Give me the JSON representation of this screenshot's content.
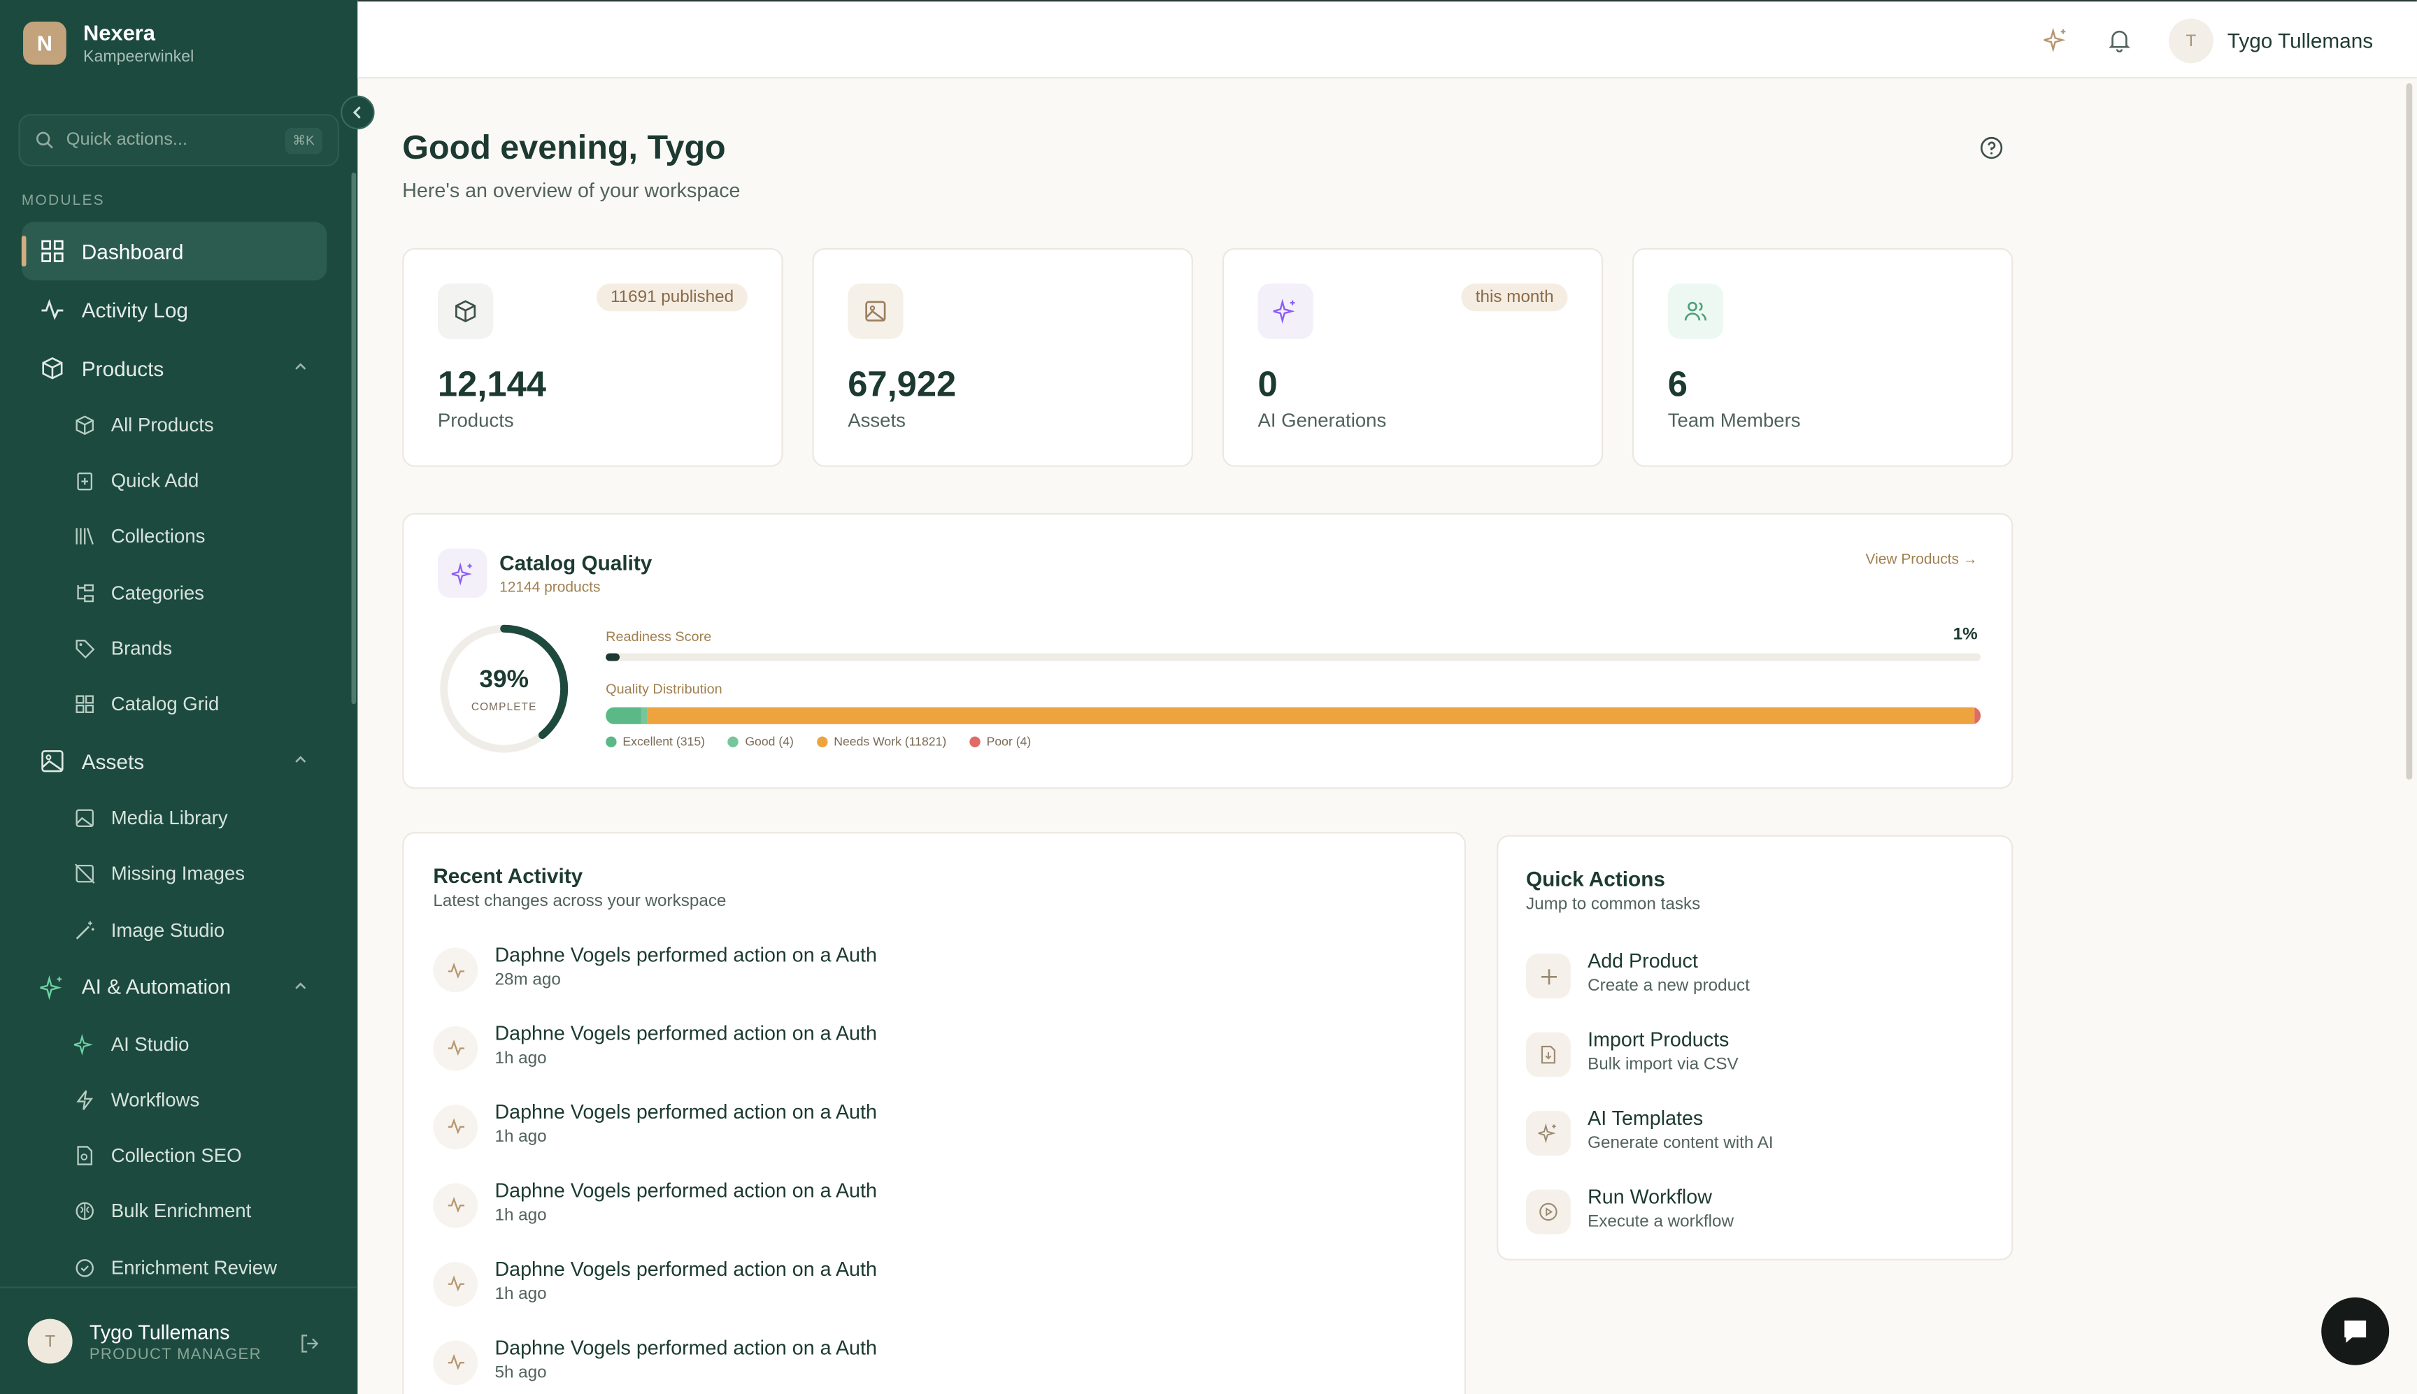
{
  "brand": {
    "initial": "N",
    "name": "Nexera",
    "subtitle": "Kampeerwinkel"
  },
  "search": {
    "placeholder": "Quick actions...",
    "shortcut": "⌘K"
  },
  "sidebar": {
    "section_label": "MODULES",
    "dashboard": "Dashboard",
    "activity_log": "Activity Log",
    "products": {
      "label": "Products",
      "items": [
        "All Products",
        "Quick Add",
        "Collections",
        "Categories",
        "Brands",
        "Catalog Grid"
      ]
    },
    "assets": {
      "label": "Assets",
      "items": [
        "Media Library",
        "Missing Images",
        "Image Studio"
      ]
    },
    "ai": {
      "label": "AI & Automation",
      "items": [
        "AI Studio",
        "Workflows",
        "Collection SEO",
        "Bulk Enrichment",
        "Enrichment Review"
      ]
    }
  },
  "user": {
    "initial": "T",
    "name": "Tygo Tullemans",
    "role": "PRODUCT MANAGER"
  },
  "header": {
    "initial": "T",
    "name": "Tygo Tullemans"
  },
  "greeting": {
    "title": "Good evening, Tygo",
    "subtitle": "Here's an overview of your workspace"
  },
  "stats": [
    {
      "value": "12,144",
      "label": "Products",
      "badge": "11691 published",
      "icon": "box-icon",
      "color": "#3d4f49"
    },
    {
      "value": "67,922",
      "label": "Assets",
      "badge": "",
      "icon": "image-icon",
      "color": "#9a7f5f"
    },
    {
      "value": "0",
      "label": "AI Generations",
      "badge": "this month",
      "icon": "sparkles-icon",
      "color": "#8b5cf6"
    },
    {
      "value": "6",
      "label": "Team Members",
      "badge": "",
      "icon": "users-icon",
      "color": "#4aa37a"
    }
  ],
  "quality": {
    "title": "Catalog Quality",
    "subtitle": "12144 products",
    "link": "View Products →",
    "complete_pct": "39%",
    "complete_label": "COMPLETE",
    "complete_value": 0.39,
    "readiness_label": "Readiness Score",
    "readiness_pct": "1%",
    "readiness_value": 0.01,
    "distribution_label": "Quality Distribution",
    "distribution": {
      "excellent": 315,
      "good": 4,
      "needs_work": 11821,
      "poor": 4
    },
    "legend": [
      "Excellent (315)",
      "Good (4)",
      "Needs Work (11821)",
      "Poor (4)"
    ]
  },
  "activity": {
    "title": "Recent Activity",
    "subtitle": "Latest changes across your workspace",
    "items": [
      {
        "user": "Daphne Vogels",
        "action": "performed action on a Auth",
        "time": "28m ago"
      },
      {
        "user": "Daphne Vogels",
        "action": "performed action on a Auth",
        "time": "1h ago"
      },
      {
        "user": "Daphne Vogels",
        "action": "performed action on a Auth",
        "time": "1h ago"
      },
      {
        "user": "Daphne Vogels",
        "action": "performed action on a Auth",
        "time": "1h ago"
      },
      {
        "user": "Daphne Vogels",
        "action": "performed action on a Auth",
        "time": "1h ago"
      },
      {
        "user": "Daphne Vogels",
        "action": "performed action on a Auth",
        "time": "5h ago"
      }
    ]
  },
  "quick": {
    "title": "Quick Actions",
    "subtitle": "Jump to common tasks",
    "items": [
      {
        "title": "Add Product",
        "sub": "Create a new product",
        "icon": "plus-icon"
      },
      {
        "title": "Import Products",
        "sub": "Bulk import via CSV",
        "icon": "file-import-icon"
      },
      {
        "title": "AI Templates",
        "sub": "Generate content with AI",
        "icon": "sparkles-icon"
      },
      {
        "title": "Run Workflow",
        "sub": "Execute a workflow",
        "icon": "play-circle-icon"
      }
    ]
  }
}
